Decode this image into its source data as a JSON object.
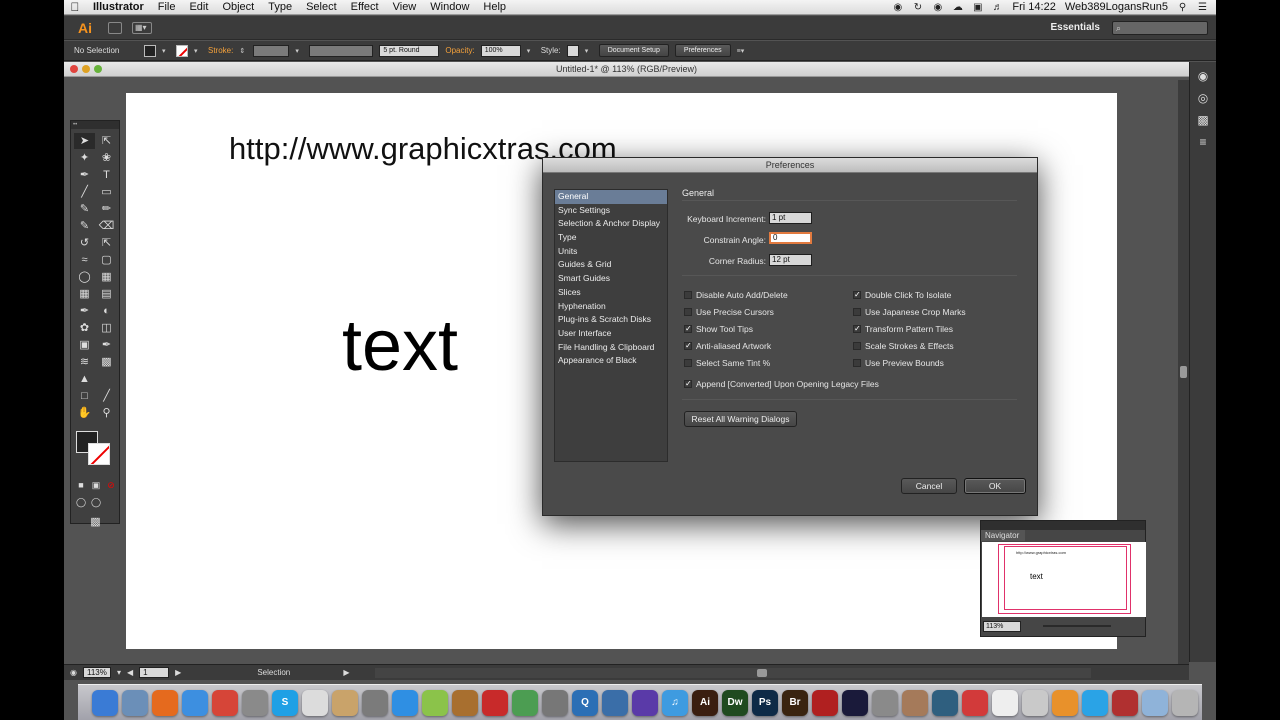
{
  "menubar": {
    "app_name": "Illustrator",
    "items": [
      "File",
      "Edit",
      "Object",
      "Type",
      "Select",
      "Effect",
      "View",
      "Window",
      "Help"
    ],
    "clock": "Fri 14:22",
    "user": "Web389LogansRun5"
  },
  "appbar": {
    "logo": "Ai",
    "workspace": "Essentials",
    "search_placeholder": "⌕"
  },
  "controlbar": {
    "selection": "No Selection",
    "stroke_label": "Stroke:",
    "brush": "5 pt. Round",
    "opacity_label": "Opacity:",
    "opacity_value": "100%",
    "style_label": "Style:",
    "doc_setup": "Document Setup",
    "preferences": "Preferences"
  },
  "document": {
    "title": "Untitled-1* @ 113% (RGB/Preview)",
    "url_text": "http://www.graphicxtras.com",
    "big_text": "text"
  },
  "statusbar": {
    "zoom": "113%",
    "page": "1",
    "tool": "Selection"
  },
  "preferences": {
    "title": "Preferences",
    "categories": [
      "General",
      "Sync Settings",
      "Selection & Anchor Display",
      "Type",
      "Units",
      "Guides & Grid",
      "Smart Guides",
      "Slices",
      "Hyphenation",
      "Plug-ins & Scratch Disks",
      "User Interface",
      "File Handling & Clipboard",
      "Appearance of Black"
    ],
    "selected_category": "General",
    "heading": "General",
    "keyboard_increment_label": "Keyboard Increment:",
    "keyboard_increment": "1 pt",
    "constrain_angle_label": "Constrain Angle:",
    "constrain_angle": "0",
    "corner_radius_label": "Corner Radius:",
    "corner_radius": "12 pt",
    "checkboxes_left": [
      {
        "label": "Disable Auto Add/Delete",
        "checked": false
      },
      {
        "label": "Use Precise Cursors",
        "checked": false
      },
      {
        "label": "Show Tool Tips",
        "checked": true
      },
      {
        "label": "Anti-aliased Artwork",
        "checked": true
      },
      {
        "label": "Select Same Tint %",
        "checked": false
      }
    ],
    "checkboxes_right": [
      {
        "label": "Double Click To Isolate",
        "checked": true
      },
      {
        "label": "Use Japanese Crop Marks",
        "checked": false
      },
      {
        "label": "Transform Pattern Tiles",
        "checked": true
      },
      {
        "label": "Scale Strokes & Effects",
        "checked": false
      },
      {
        "label": "Use Preview Bounds",
        "checked": false
      }
    ],
    "append_label": "Append [Converted] Upon Opening Legacy Files",
    "append_checked": true,
    "reset_label": "Reset All Warning Dialogs",
    "cancel_label": "Cancel",
    "ok_label": "OK"
  },
  "navigator": {
    "tab": "Navigator",
    "zoom": "113%",
    "thumb_url": "http://www.graphicxtras.com",
    "thumb_text": "text"
  },
  "dock": {
    "apps": [
      {
        "name": "finder-icon",
        "label": "",
        "color": "#3a7bd5"
      },
      {
        "name": "preview-icon",
        "label": "",
        "color": "#6b8fb8"
      },
      {
        "name": "firefox-icon",
        "label": "",
        "color": "#e56a1e"
      },
      {
        "name": "safari-icon",
        "label": "",
        "color": "#3d8fe0"
      },
      {
        "name": "chrome-icon",
        "label": "",
        "color": "#d64538"
      },
      {
        "name": "system-prefs-icon",
        "label": "",
        "color": "#8a8a8a"
      },
      {
        "name": "skype-icon",
        "label": "S",
        "color": "#1fa0e5"
      },
      {
        "name": "textedit-icon",
        "label": "",
        "color": "#dcdcdc"
      },
      {
        "name": "notes-icon",
        "label": "",
        "color": "#c9a36a"
      },
      {
        "name": "utility-icon",
        "label": "",
        "color": "#7b7b7b"
      },
      {
        "name": "appstore-icon",
        "label": "",
        "color": "#2f8fe3"
      },
      {
        "name": "gamecenter-icon",
        "label": "",
        "color": "#8bc34a"
      },
      {
        "name": "garageband-icon",
        "label": "",
        "color": "#a86f2f"
      },
      {
        "name": "app-red-icon",
        "label": "",
        "color": "#c82a2a"
      },
      {
        "name": "app-green-icon",
        "label": "",
        "color": "#4c9d52"
      },
      {
        "name": "app-gray-icon",
        "label": "",
        "color": "#777777"
      },
      {
        "name": "quicktime-icon",
        "label": "Q",
        "color": "#2b6fb5"
      },
      {
        "name": "app-globe-icon",
        "label": "",
        "color": "#3a6ea8"
      },
      {
        "name": "app-flower-icon",
        "label": "",
        "color": "#5a3aa8"
      },
      {
        "name": "itunes-icon",
        "label": "♫",
        "color": "#3e9be0"
      },
      {
        "name": "illustrator-icon",
        "label": "Ai",
        "color": "#3a1e10"
      },
      {
        "name": "dreamweaver-icon",
        "label": "Dw",
        "color": "#1f4a1f"
      },
      {
        "name": "photoshop-icon",
        "label": "Ps",
        "color": "#0e2a47"
      },
      {
        "name": "bridge-icon",
        "label": "Br",
        "color": "#3a2410"
      },
      {
        "name": "acrobat-icon",
        "label": "",
        "color": "#b02020"
      },
      {
        "name": "app-dark-icon",
        "label": "",
        "color": "#1a1a3a"
      },
      {
        "name": "app-pen-icon",
        "label": "",
        "color": "#8a8a8a"
      },
      {
        "name": "app-photo-icon",
        "label": "",
        "color": "#a57a5a"
      },
      {
        "name": "app-bucket-icon",
        "label": "",
        "color": "#2f5f7f"
      },
      {
        "name": "app-pdf-icon",
        "label": "",
        "color": "#d23a3a"
      },
      {
        "name": "app-doc-icon",
        "label": "",
        "color": "#eeeeee"
      },
      {
        "name": "app-preview2-icon",
        "label": "",
        "color": "#c9c9c9"
      },
      {
        "name": "app-orange-icon",
        "label": "",
        "color": "#e8912b"
      },
      {
        "name": "twitter-icon",
        "label": "",
        "color": "#2aa3e6"
      },
      {
        "name": "app-camera-icon",
        "label": "",
        "color": "#b03030"
      },
      {
        "name": "downloads-icon",
        "label": "",
        "color": "#8fb3d9"
      },
      {
        "name": "trash-icon",
        "label": "",
        "color": "#b5b5b5"
      }
    ]
  }
}
